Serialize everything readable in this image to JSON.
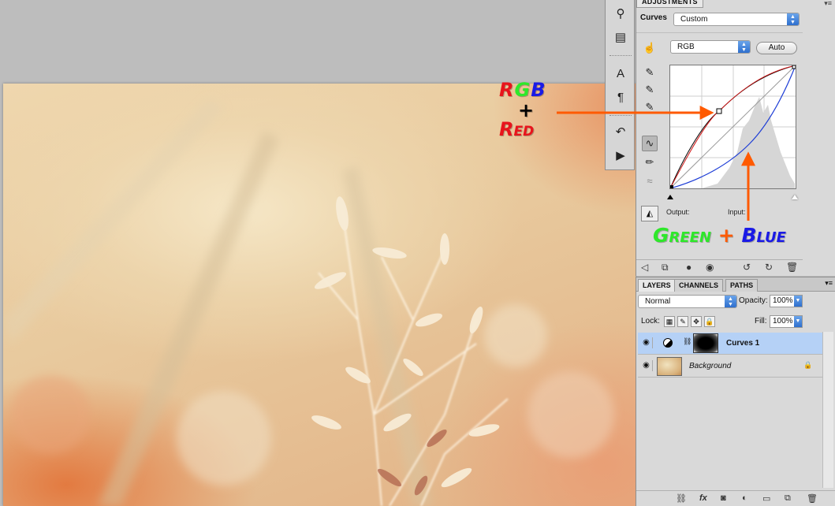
{
  "adjustments": {
    "tab_label": "ADJUSTMENTS",
    "menu_icon": "panel-menu-icon",
    "curves_label": "Curves",
    "preset_value": "Custom",
    "channel_value": "RGB",
    "auto_label": "Auto",
    "output_label": "Output:",
    "input_label": "Input:"
  },
  "tools": [
    "target-adjust-icon",
    "layer-comp-icon",
    "character-icon",
    "paragraph-icon",
    "history-icon",
    "action-icon"
  ],
  "layers": {
    "tabs": [
      "LAYERS",
      "CHANNELS",
      "PATHS"
    ],
    "blend_mode": "Normal",
    "opacity_label": "Opacity:",
    "opacity_value": "100%",
    "lock_label": "Lock:",
    "fill_label": "Fill:",
    "fill_value": "100%",
    "items": [
      {
        "name": "Curves 1",
        "selected": true
      },
      {
        "name": "Background",
        "selected": false
      }
    ]
  },
  "annotations": {
    "rgb_r": "R",
    "rgb_g": "G",
    "rgb_b": "B",
    "plus": "+",
    "red": "Red",
    "green": "Green",
    "plus2": "+",
    "blue": "Blue"
  },
  "colors": {
    "annotation_red": "#e8141c",
    "annotation_green": "#2ee82a",
    "annotation_blue": "#1a1ae6",
    "arrow_orange": "#ff5a00",
    "selected_row": "#b5d1f6"
  }
}
